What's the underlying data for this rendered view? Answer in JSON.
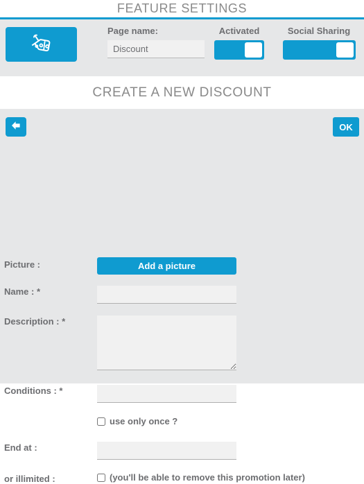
{
  "feature_section": {
    "title": "FEATURE SETTINGS",
    "accent_color": "#0f9bd0",
    "panel_bg": "#e6e7e8",
    "label_color": "#6d6e71",
    "icon": {
      "name": "discount-tag-percent-icon",
      "label": "discount tag"
    },
    "page_name": {
      "label": "Page name:",
      "value": "Discount",
      "placeholder": ""
    },
    "toggles": [
      {
        "label": "Activated",
        "state": "on",
        "name": "activated"
      },
      {
        "label": "Social Sharing",
        "state": "on",
        "name": "social-sharing"
      }
    ]
  },
  "create_section": {
    "title": "CREATE A NEW DISCOUNT",
    "back_button": {
      "icon": "arrow-left-icon",
      "label": ""
    },
    "ok_button": {
      "label": "OK"
    },
    "fields": {
      "picture": {
        "label": "Picture :",
        "button_label": "Add a picture"
      },
      "name": {
        "label": "Name : *",
        "value": "",
        "placeholder": ""
      },
      "description": {
        "label": "Description : *",
        "value": "",
        "placeholder": ""
      },
      "conditions": {
        "label": "Conditions : *",
        "value": "",
        "placeholder": ""
      },
      "use_only_once": {
        "label": "use only once ?",
        "checked": false
      },
      "end_at": {
        "label": "End at :",
        "value": "",
        "placeholder": ""
      },
      "illimited": {
        "label": "or illimited :",
        "note": "(you'll be able to remove this promotion later)",
        "checked": false
      }
    }
  }
}
